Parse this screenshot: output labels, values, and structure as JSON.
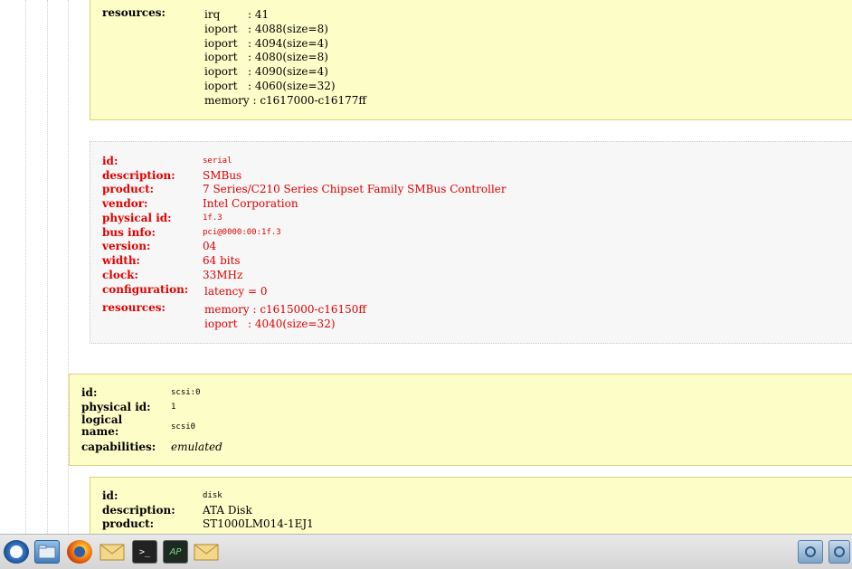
{
  "block1": {
    "resources_label": "resources:",
    "resources": [
      {
        "name": "irq",
        "sep": ":",
        "value": "41"
      },
      {
        "name": "ioport",
        "sep": ":",
        "value": "4088(size=8)"
      },
      {
        "name": "ioport",
        "sep": ":",
        "value": "4094(size=4)"
      },
      {
        "name": "ioport",
        "sep": ":",
        "value": "4080(size=8)"
      },
      {
        "name": "ioport",
        "sep": ":",
        "value": "4090(size=4)"
      },
      {
        "name": "ioport",
        "sep": ":",
        "value": "4060(size=32)"
      },
      {
        "name": "memory",
        "sep": ":",
        "value": "c1617000-c16177ff"
      }
    ]
  },
  "serial": {
    "fields": [
      {
        "key": "id:",
        "value": "serial"
      },
      {
        "key": "description:",
        "value": "SMBus"
      },
      {
        "key": "product:",
        "value": "7 Series/C210 Series Chipset Family SMBus Controller"
      },
      {
        "key": "vendor:",
        "value": "Intel Corporation"
      },
      {
        "key": "physical id:",
        "value": "1f.3"
      },
      {
        "key": "bus info:",
        "value": "pci@0000:00:1f.3"
      },
      {
        "key": "version:",
        "value": "04"
      },
      {
        "key": "width:",
        "value": "64 bits"
      },
      {
        "key": "clock:",
        "value": "33MHz"
      }
    ],
    "configuration_label": "configuration:",
    "configuration_value": "latency = 0",
    "resources_label": "resources:",
    "resources": [
      {
        "name": "memory",
        "sep": ":",
        "value": "c1615000-c16150ff"
      },
      {
        "name": "ioport",
        "sep": ":",
        "value": "4040(size=32)"
      }
    ]
  },
  "scsi": {
    "id_key": "id:",
    "id_value": "scsi:0",
    "physical_key": "physical id:",
    "physical_value": "1",
    "logical_key_1": "logical",
    "logical_key_2": "name:",
    "logical_value": "scsi0",
    "capabilities_key": "capabilities:",
    "capabilities_value": "emulated"
  },
  "disk": {
    "id_key": "id:",
    "id_value": "disk",
    "description_key": "description:",
    "description_value": "ATA Disk",
    "product_key": "product:",
    "product_value": "ST1000LM014-1EJ1"
  },
  "taskbar": {
    "icons": [
      "app-menu-icon",
      "file-manager-icon",
      "firefox-icon",
      "mail-icon",
      "terminal-icon",
      "system-monitor-icon",
      "mail-icon-2"
    ],
    "terminal_glyph": ">_",
    "monitor_glyph": "AP"
  }
}
